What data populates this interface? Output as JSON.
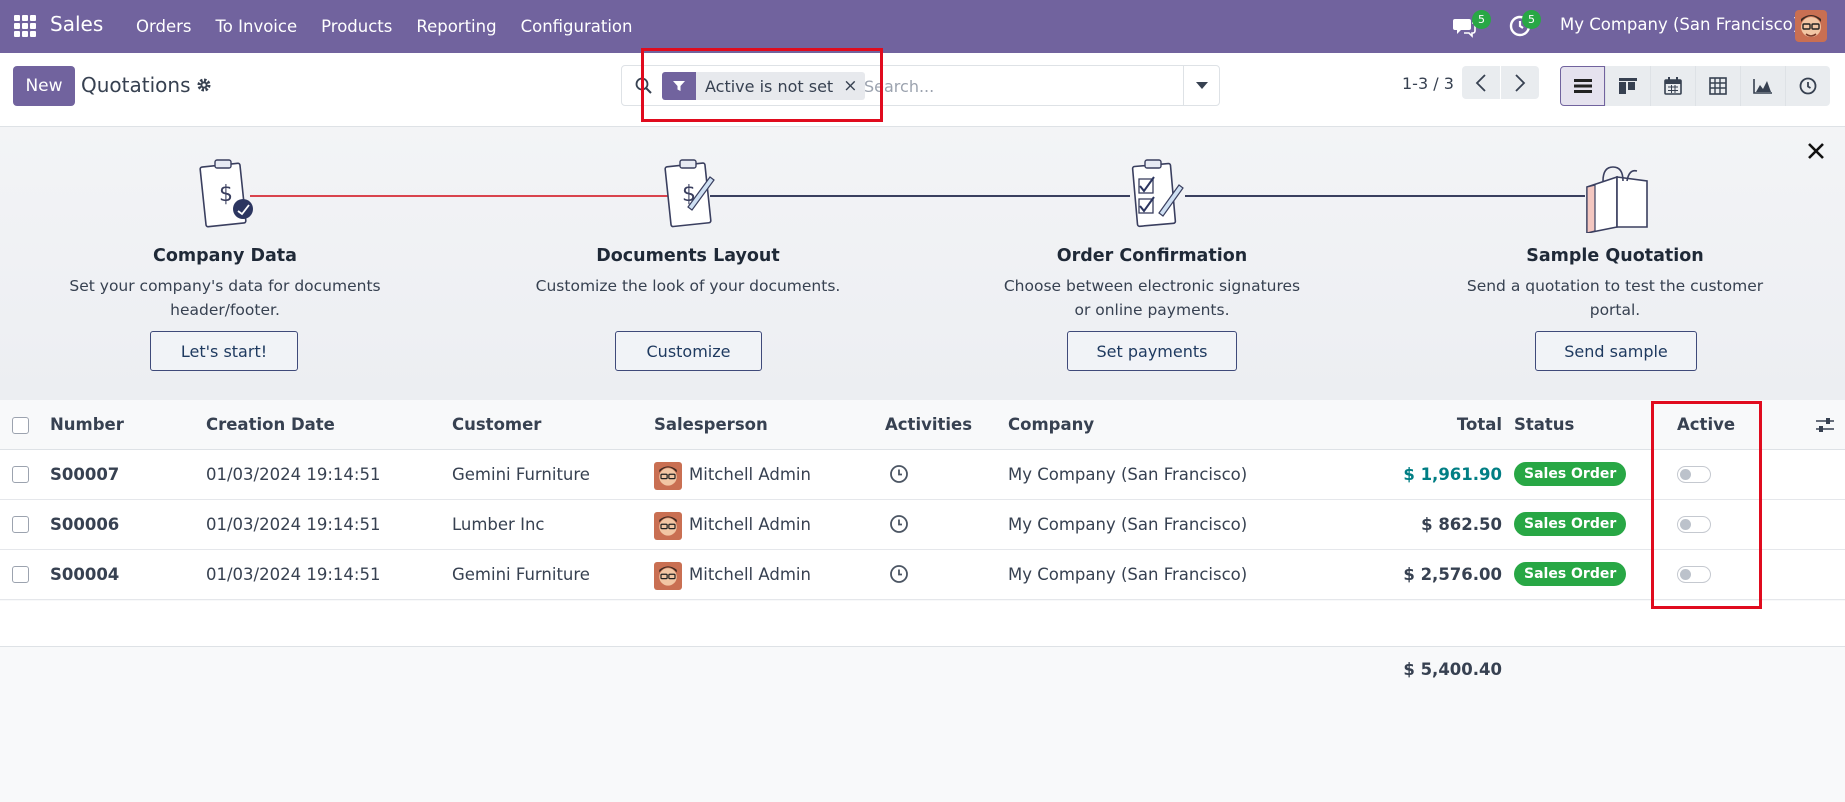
{
  "navbar": {
    "app_name": "Sales",
    "menu": [
      "Orders",
      "To Invoice",
      "Products",
      "Reporting",
      "Configuration"
    ],
    "messages_count": "5",
    "activities_count": "5",
    "company": "My Company (San Francisco)",
    "icons": [
      "apps-icon",
      "chat-icon",
      "clock-icon",
      "user-avatar"
    ],
    "color": "#71639e"
  },
  "control": {
    "new_label": "New",
    "title": "Quotations",
    "search": {
      "facet_label": "Active is not set",
      "placeholder": "Search..."
    },
    "pager": "1-3 / 3",
    "views": [
      "list-view-icon",
      "kanban-view-icon",
      "calendar-view-icon",
      "pivot-view-icon",
      "graph-view-icon",
      "activity-view-icon"
    ]
  },
  "onboarding": {
    "steps": [
      {
        "title": "Company Data",
        "desc_line1": "Set your company's data for documents",
        "desc_line2": "header/footer.",
        "button": "Let's start!"
      },
      {
        "title": "Documents Layout",
        "desc_line1": "Customize the look of your documents.",
        "desc_line2": "",
        "button": "Customize"
      },
      {
        "title": "Order Confirmation",
        "desc_line1": "Choose between electronic signatures",
        "desc_line2": "or online payments.",
        "button": "Set payments"
      },
      {
        "title": "Sample Quotation",
        "desc_line1": "Send a quotation to test the customer",
        "desc_line2": "portal.",
        "button": "Send sample"
      }
    ]
  },
  "list": {
    "headers": {
      "number": "Number",
      "creation_date": "Creation Date",
      "customer": "Customer",
      "salesperson": "Salesperson",
      "activities": "Activities",
      "company": "Company",
      "total": "Total",
      "status": "Status",
      "active": "Active"
    },
    "rows": [
      {
        "number": "S00007",
        "date": "01/03/2024 19:14:51",
        "customer": "Gemini Furniture",
        "salesperson": "Mitchell Admin",
        "company": "My Company (San Francisco)",
        "total": "$ 1,961.90",
        "status": "Sales Order",
        "active": false
      },
      {
        "number": "S00006",
        "date": "01/03/2024 19:14:51",
        "customer": "Lumber Inc",
        "salesperson": "Mitchell Admin",
        "company": "My Company (San Francisco)",
        "total": "$ 862.50",
        "status": "Sales Order",
        "active": false
      },
      {
        "number": "S00004",
        "date": "01/03/2024 19:14:51",
        "customer": "Gemini Furniture",
        "salesperson": "Mitchell Admin",
        "company": "My Company (San Francisco)",
        "total": "$ 2,576.00",
        "status": "Sales Order",
        "active": false
      }
    ],
    "grand_total": "$ 5,400.40",
    "colors": {
      "link": "#017e84",
      "status": "#28a745"
    }
  }
}
